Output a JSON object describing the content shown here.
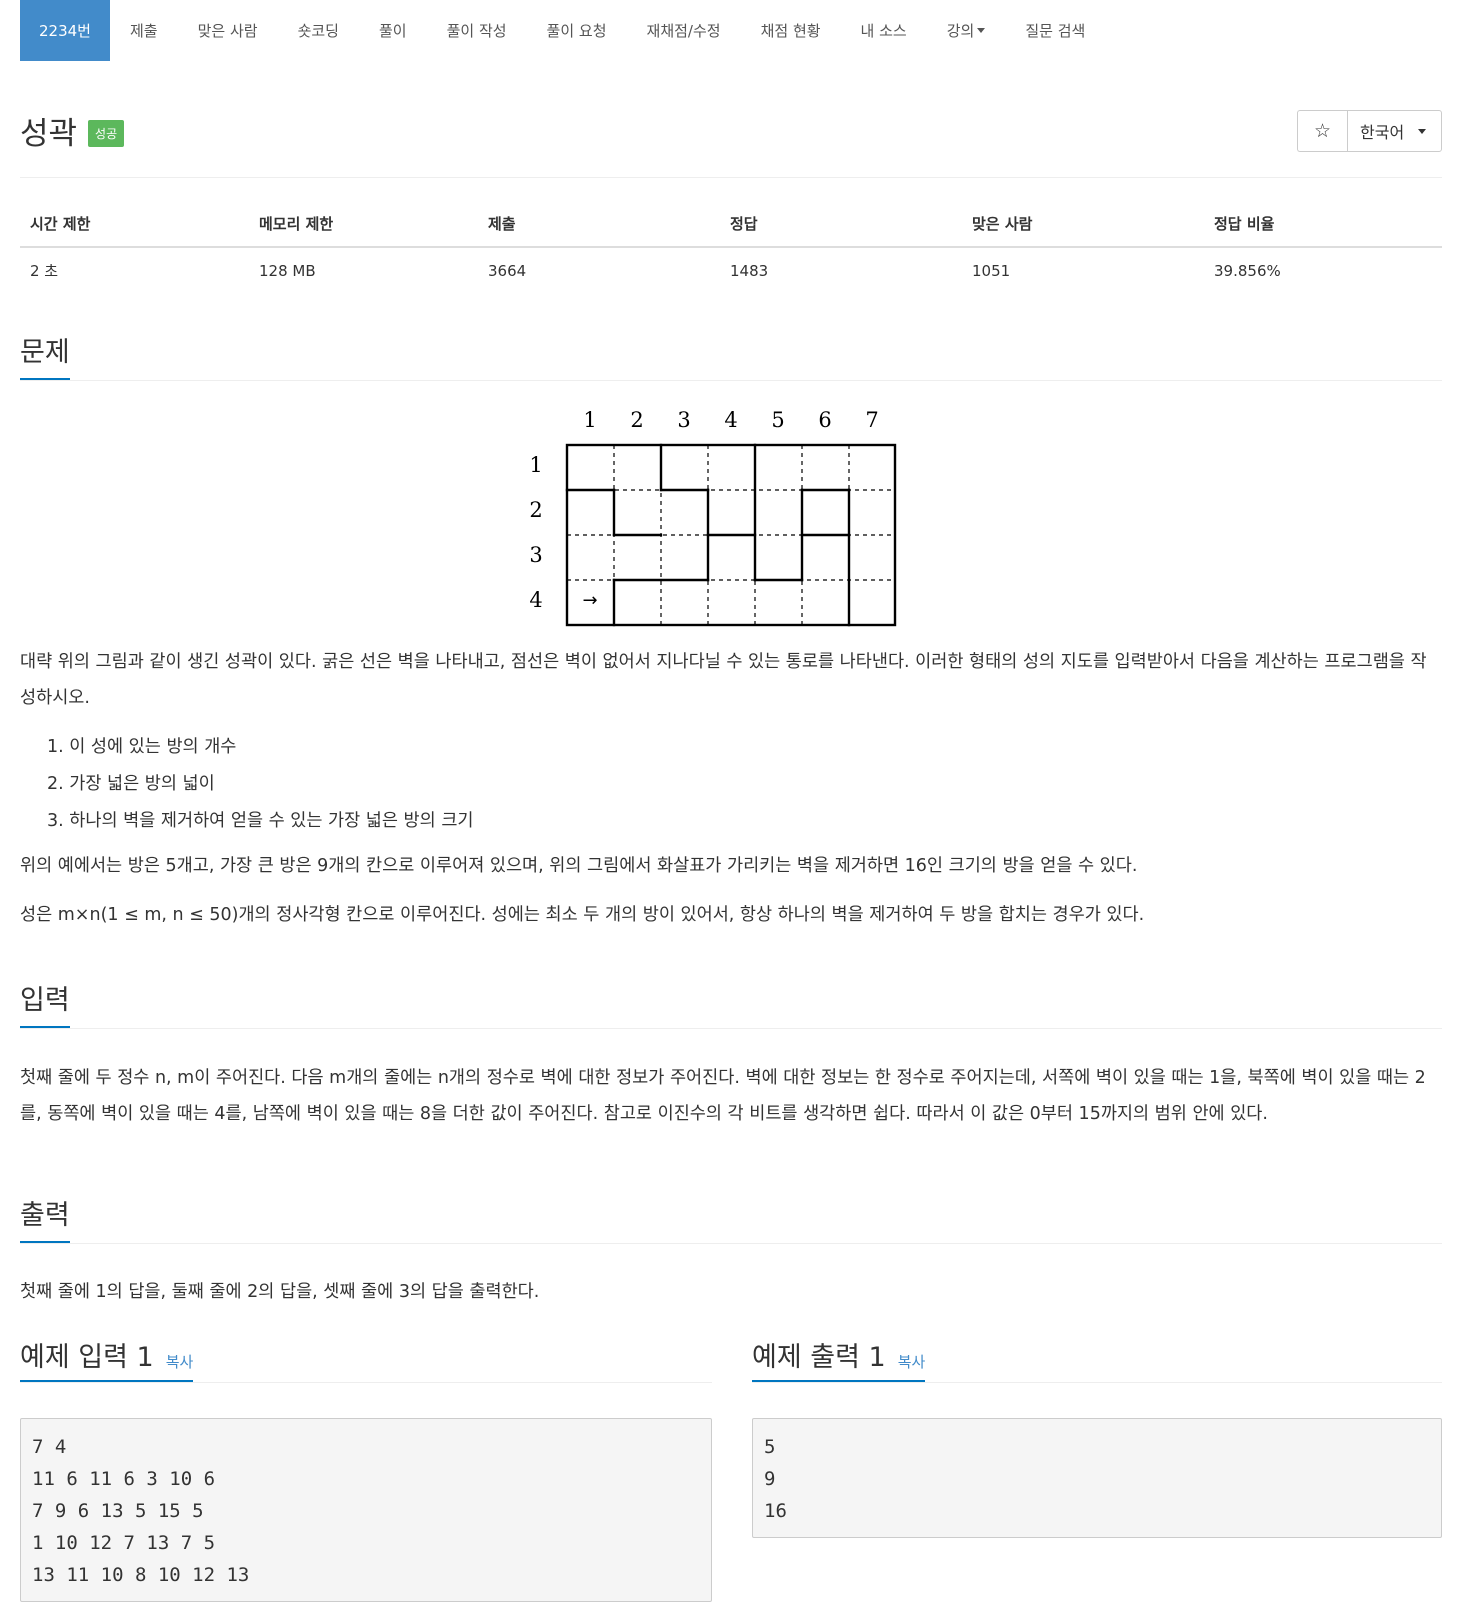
{
  "nav": {
    "items": [
      {
        "label": "2234번",
        "active": true
      },
      {
        "label": "제출"
      },
      {
        "label": "맞은 사람"
      },
      {
        "label": "숏코딩"
      },
      {
        "label": "풀이"
      },
      {
        "label": "풀이 작성"
      },
      {
        "label": "풀이 요청"
      },
      {
        "label": "재채점/수정"
      },
      {
        "label": "채점 현황"
      },
      {
        "label": "내 소스"
      },
      {
        "label": "강의",
        "dropdown": true
      },
      {
        "label": "질문 검색"
      }
    ]
  },
  "problem": {
    "title": "성곽",
    "status_badge": "성공",
    "star_icon": "star-icon",
    "language": "한국어"
  },
  "info": {
    "headers": [
      "시간 제한",
      "메모리 제한",
      "제출",
      "정답",
      "맞은 사람",
      "정답 비율"
    ],
    "values": [
      "2 초",
      "128 MB",
      "3664",
      "1483",
      "1051",
      "39.856%"
    ]
  },
  "figure": {
    "col_labels": [
      "1",
      "2",
      "3",
      "4",
      "5",
      "6",
      "7"
    ],
    "row_labels": [
      "1",
      "2",
      "3",
      "4"
    ],
    "arrow": "→"
  },
  "sections": {
    "problem_heading": "문제",
    "problem_text_1": "대략 위의 그림과 같이 생긴 성곽이 있다. 굵은 선은 벽을 나타내고, 점선은 벽이 없어서 지나다닐 수 있는 통로를 나타낸다. 이러한 형태의 성의 지도를 입력받아서 다음을 계산하는 프로그램을 작성하시오.",
    "list": [
      "1. 이 성에 있는 방의 개수",
      "2. 가장 넓은 방의 넓이",
      "3. 하나의 벽을 제거하여 얻을 수 있는 가장 넓은 방의 크기"
    ],
    "problem_text_2": "위의 예에서는 방은 5개고, 가장 큰 방은 9개의 칸으로 이루어져 있으며, 위의 그림에서 화살표가 가리키는 벽을 제거하면 16인 크기의 방을 얻을 수 있다.",
    "problem_text_3": "성은 m×n(1 ≤ m, n ≤ 50)개의 정사각형 칸으로 이루어진다. 성에는 최소 두 개의 방이 있어서, 항상 하나의 벽을 제거하여 두 방을 합치는 경우가 있다.",
    "input_heading": "입력",
    "input_text": "첫째 줄에 두 정수 n, m이 주어진다. 다음 m개의 줄에는 n개의 정수로 벽에 대한 정보가 주어진다. 벽에 대한 정보는 한 정수로 주어지는데, 서쪽에 벽이 있을 때는 1을, 북쪽에 벽이 있을 때는 2를, 동쪽에 벽이 있을 때는 4를, 남쪽에 벽이 있을 때는 8을 더한 값이 주어진다. 참고로 이진수의 각 비트를 생각하면 쉽다. 따라서 이 값은 0부터 15까지의 범위 안에 있다.",
    "output_heading": "출력",
    "output_text": "첫째 줄에 1의 답을, 둘째 줄에 2의 답을, 셋째 줄에 3의 답을 출력한다."
  },
  "examples": {
    "input_heading": "예제 입력 1",
    "output_heading": "예제 출력 1",
    "copy_label": "복사",
    "input_text": "7 4\n11 6 11 6 3 10 6\n7 9 6 13 5 15 5\n1 10 12 7 13 7 5\n13 11 10 8 10 12 13",
    "output_text": "5\n9\n16"
  }
}
